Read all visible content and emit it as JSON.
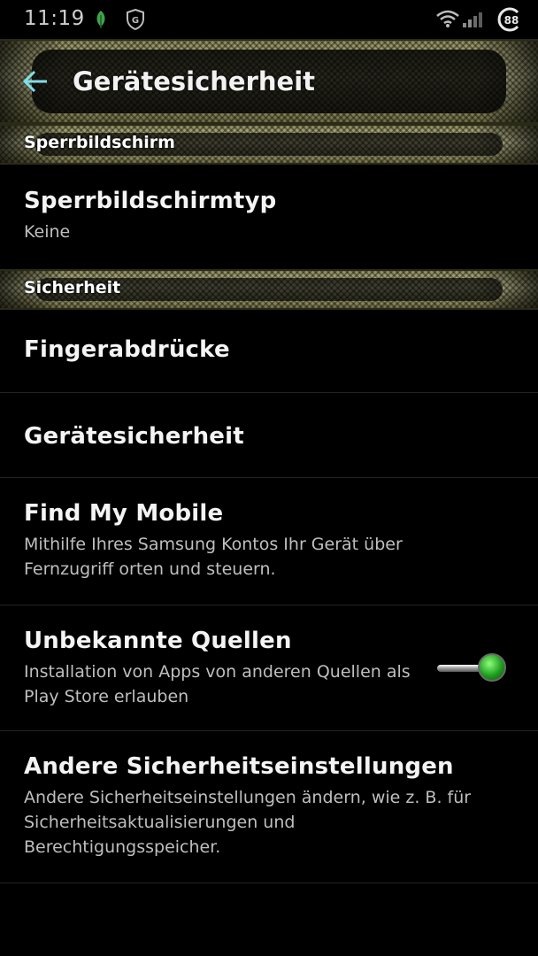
{
  "status_bar": {
    "time": "11:19",
    "icons": [
      "leaf-icon",
      "shield-g-icon",
      "wifi-icon",
      "signal-icon",
      "battery-icon"
    ],
    "battery_level": "88"
  },
  "toolbar": {
    "back_icon": "arrow-back-icon",
    "title": "Gerätesicherheit"
  },
  "sections": [
    {
      "header": "Sperrbildschirm",
      "items": [
        {
          "title": "Sperrbildschirmtyp",
          "subtitle": "Keine"
        }
      ]
    },
    {
      "header": "Sicherheit",
      "items": [
        {
          "title": "Fingerabdrücke"
        },
        {
          "title": "Gerätesicherheit"
        },
        {
          "title": "Find My Mobile",
          "subtitle": "Mithilfe Ihres Samsung Kontos Ihr Gerät über Fernzugriff orten und steuern."
        },
        {
          "title": "Unbekannte Quellen",
          "subtitle": "Installation von Apps von anderen Quellen als Play Store erlauben",
          "toggle_on": true
        },
        {
          "title": "Andere Sicherheitseinstellungen",
          "subtitle": "Andere Sicherheitseinstellungen ändern, wie z. B. für Sicherheitsaktualisierungen und Berechtigungsspeicher."
        }
      ]
    }
  ],
  "colors": {
    "accent_back_arrow": "#7fe0e8",
    "toggle_on": "#2fbf2f",
    "bar_gold": "#d6d4a3"
  }
}
